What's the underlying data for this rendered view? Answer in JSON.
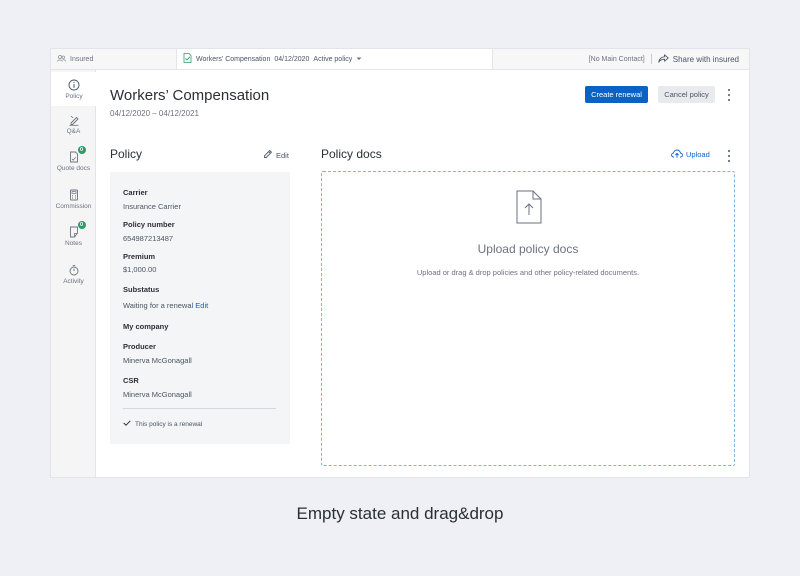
{
  "topbar": {
    "insured_label": "Insured",
    "policy_name": "Workers' Compensation",
    "policy_date": "04/12/2020",
    "policy_status": "Active policy",
    "main_contact": "[No Main Contact]",
    "share_label": "Share with insured"
  },
  "sidebar": {
    "items": [
      {
        "label": "Policy",
        "icon": "info-icon"
      },
      {
        "label": "Q&A",
        "icon": "pen-icon"
      },
      {
        "label": "Quote docs",
        "icon": "document-icon",
        "badge": "0"
      },
      {
        "label": "Commission",
        "icon": "calculator-icon"
      },
      {
        "label": "Notes",
        "icon": "note-icon",
        "badge": "0"
      },
      {
        "label": "Activity",
        "icon": "stopwatch-icon"
      }
    ]
  },
  "header": {
    "title": "Workers’ Compensation",
    "dates": "04/12/2020 – 04/12/2021",
    "create_renewal_label": "Create renewal",
    "cancel_policy_label": "Cancel policy"
  },
  "policy": {
    "title": "Policy",
    "edit_label": "Edit",
    "carrier_label": "Carrier",
    "carrier_value": "Insurance Carrier",
    "policy_number_label": "Policy number",
    "policy_number_value": "654987213487",
    "premium_label": "Premium",
    "premium_value": "$1,000.00",
    "substatus_label": "Substatus",
    "substatus_value": "Waiting for a renewal",
    "substatus_edit": "Edit",
    "my_company_label": "My company",
    "producer_label": "Producer",
    "producer_value": "Minerva McGonagall",
    "csr_label": "CSR",
    "csr_value": "Minerva McGonagall",
    "renewal_note": "This policy is a renewal"
  },
  "policy_docs": {
    "title": "Policy docs",
    "upload_label": "Upload",
    "empty_title": "Upload policy docs",
    "empty_subtitle": "Upload or drag & drop policies and other policy-related documents."
  },
  "caption": "Empty state and drag&drop",
  "colors": {
    "accent": "#0a62c4",
    "badge": "#2a9d6a",
    "background": "#eef0f5",
    "dropzone_border": "#7fb3e3"
  }
}
